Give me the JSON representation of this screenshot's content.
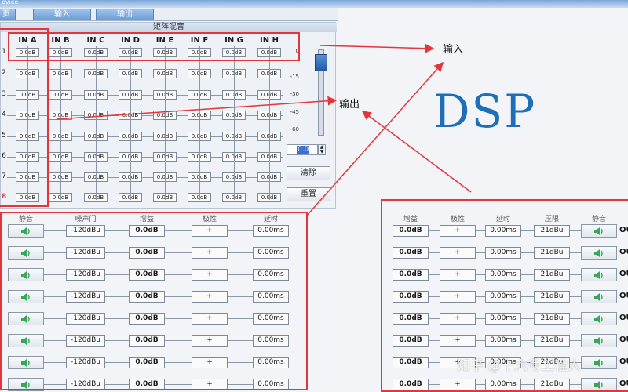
{
  "window": {
    "title": "evice"
  },
  "tabs": [
    {
      "label": "页"
    },
    {
      "label": "输入"
    },
    {
      "label": "输出"
    }
  ],
  "matrix": {
    "title": "矩阵混音",
    "columns": [
      "IN A",
      "IN B",
      "IN C",
      "IN D",
      "IN E",
      "IN F",
      "IN G",
      "IN H"
    ],
    "rows": [
      "1",
      "2",
      "3",
      "4",
      "5",
      "6",
      "7",
      "8"
    ],
    "cell_value": "0.0dB",
    "fader_scale": [
      "0",
      "-15",
      "-30",
      "-45",
      "-60"
    ],
    "fader_value": "0.0",
    "clear_label": "清除",
    "reset_label": "重置"
  },
  "annotations": {
    "input_label": "输入",
    "output_label": "输出",
    "dsp_label": "DSP",
    "dsp_color": "#1f6fb8",
    "red_color": "#e2363c",
    "watermark": "知乎 @十六号工程人"
  },
  "input_panel": {
    "headers": [
      "静音",
      "噪声门",
      "增益",
      "极性",
      "延时"
    ],
    "rows": [
      {
        "gate": "-120dBu",
        "gain": "0.0dB",
        "polarity": "+",
        "delay": "0.00ms"
      },
      {
        "gate": "-120dBu",
        "gain": "0.0dB",
        "polarity": "+",
        "delay": "0.00ms"
      },
      {
        "gate": "-120dBu",
        "gain": "0.0dB",
        "polarity": "+",
        "delay": "0.00ms"
      },
      {
        "gate": "-120dBu",
        "gain": "0.0dB",
        "polarity": "+",
        "delay": "0.00ms"
      },
      {
        "gate": "-120dBu",
        "gain": "0.0dB",
        "polarity": "+",
        "delay": "0.00ms"
      },
      {
        "gate": "-120dBu",
        "gain": "0.0dB",
        "polarity": "+",
        "delay": "0.00ms"
      },
      {
        "gate": "-120dBu",
        "gain": "0.0dB",
        "polarity": "+",
        "delay": "0.00ms"
      },
      {
        "gate": "-120dBu",
        "gain": "0.0dB",
        "polarity": "+",
        "delay": "0.00ms"
      }
    ]
  },
  "output_panel": {
    "headers": [
      "增益",
      "极性",
      "延时",
      "压限",
      "静音"
    ],
    "rows": [
      {
        "gain": "0.0dB",
        "polarity": "+",
        "delay": "0.00ms",
        "limit": "21dBu",
        "tag": "OU"
      },
      {
        "gain": "0.0dB",
        "polarity": "+",
        "delay": "0.00ms",
        "limit": "21dBu",
        "tag": "OU"
      },
      {
        "gain": "0.0dB",
        "polarity": "+",
        "delay": "0.00ms",
        "limit": "21dBu",
        "tag": "OU"
      },
      {
        "gain": "0.0dB",
        "polarity": "+",
        "delay": "0.00ms",
        "limit": "21dBu",
        "tag": "OU"
      },
      {
        "gain": "0.0dB",
        "polarity": "+",
        "delay": "0.00ms",
        "limit": "21dBu",
        "tag": "OU"
      },
      {
        "gain": "0.0dB",
        "polarity": "+",
        "delay": "0.00ms",
        "limit": "21dBu",
        "tag": "OU"
      },
      {
        "gain": "0.0dB",
        "polarity": "+",
        "delay": "0.00ms",
        "limit": "21dBu",
        "tag": "OU"
      },
      {
        "gain": "0.0dB",
        "polarity": "+",
        "delay": "0.00ms",
        "limit": "21dBu",
        "tag": "OU"
      }
    ]
  }
}
